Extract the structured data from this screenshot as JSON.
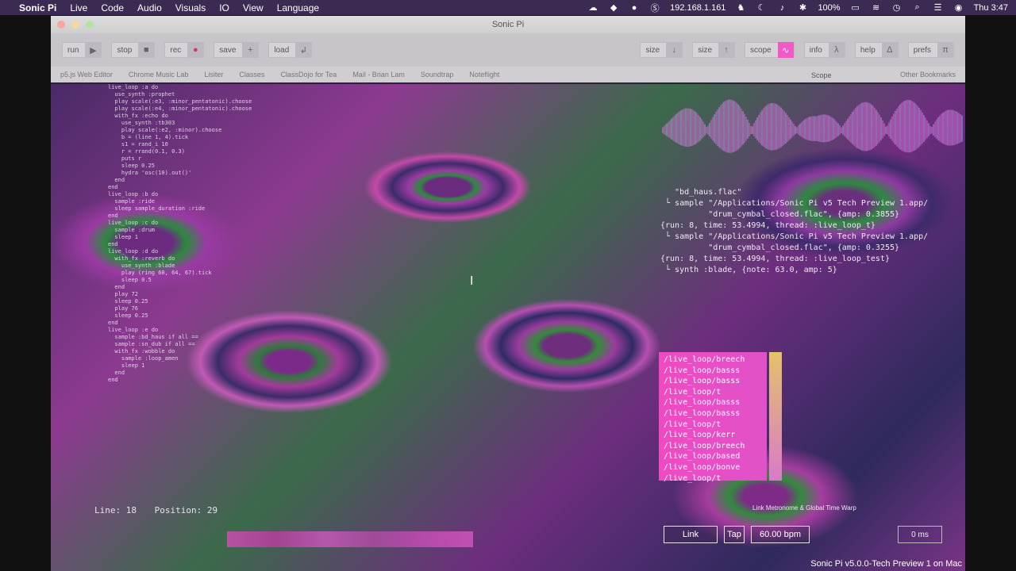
{
  "menubar": {
    "app": "Sonic Pi",
    "items": [
      "Live",
      "Code",
      "Audio",
      "Visuals",
      "IO",
      "View",
      "Language"
    ],
    "ip": "192.168.1.161",
    "battery": "100%",
    "clock": "Thu 3:47"
  },
  "window": {
    "title": "Sonic Pi"
  },
  "toolbar": {
    "run": "run",
    "stop": "stop",
    "rec": "rec",
    "save": "save",
    "load": "load",
    "size_down": "size",
    "size_up": "size",
    "scope": "scope",
    "info": "info",
    "help": "help",
    "prefs": "prefs"
  },
  "bookmarks": {
    "items": [
      "p5.js Web Editor",
      "Chrome Music Lab",
      "Lisiter",
      "Classes",
      "ClassDojo for Tea",
      "Mail - Brian Lam",
      "Soundtrap",
      "Noteflight",
      "Other Bookmarks"
    ],
    "scope_label": "Scope"
  },
  "code_lines": [
    "live_loop :a do",
    "  use_synth :prophet",
    "  play scale(:e3, :minor_pentatonic).choose",
    "  play scale(:e4, :minor_pentatonic).choose",
    "  with_fx :echo do",
    "    use_synth :tb303",
    "    play scale(:e2, :minor).choose",
    "    b = (line 1, 4).tick",
    "    s1 = rand_i 10",
    "    r = rrand(0.1, 0.3)",
    "    puts r",
    "    sleep 0.25",
    "    hydra 'osc(10).out()'",
    "  end",
    "end",
    "",
    "live_loop :b do",
    "  sample :ride",
    "  sleep sample_duration :ride",
    "end",
    "",
    "live_loop :c do",
    "  sample :drum",
    "  sleep 1",
    "end",
    "",
    "live_loop :d do",
    "  with_fx :reverb do",
    "    use_synth :blade",
    "    play (ring 60, 64, 67).tick",
    "    sleep 0.5",
    "  end",
    "  play 72",
    "  sleep 0.25",
    "  play 76",
    "  sleep 0.25",
    "end",
    "",
    "live_loop :e do",
    "  sample :bd_haus if all ==",
    "  sample :sn_dub if all ==",
    "  with_fx :wobble do",
    "    sample :loop_amen",
    "    sleep 1",
    "  end",
    "end"
  ],
  "log_lines": [
    "   \"bd_haus.flac\"",
    " └ sample \"/Applications/Sonic Pi v5 Tech Preview 1.app/",
    "          \"drum_cymbal_closed.flac\", {amp: 0.3855}",
    "",
    "{run: 8, time: 53.4994, thread: :live_loop_t}",
    " └ sample \"/Applications/Sonic Pi v5 Tech Preview 1.app/",
    "          \"drum_cymbal_closed.flac\", {amp: 0.3255}",
    "",
    "{run: 8, time: 53.4994, thread: :live_loop_test}",
    " └ synth :blade, {note: 63.0, amp: 5}"
  ],
  "cues": [
    "/live_loop/breech",
    "/live_loop/basss",
    "/live_loop/basss",
    "/live_loop/t",
    "/live_loop/basss",
    "/live_loop/basss",
    "/live_loop/t",
    "/live_loop/kerr",
    "/live_loop/breech",
    "/live_loop/based",
    "/live_loop/bonve",
    "/live_loop/t"
  ],
  "status": {
    "line": "Line: 18",
    "position": "Position: 29"
  },
  "link": {
    "meta": "Link Metronome & Global Time Warp",
    "link_label": "Link",
    "tap_label": "Tap",
    "bpm": "60.00 bpm",
    "latency": "0 ms"
  },
  "version": "Sonic Pi v5.0.0-Tech Preview 1 on Mac",
  "colors": {
    "accent": "#f05ac4",
    "menubar": "#3b2a52"
  }
}
